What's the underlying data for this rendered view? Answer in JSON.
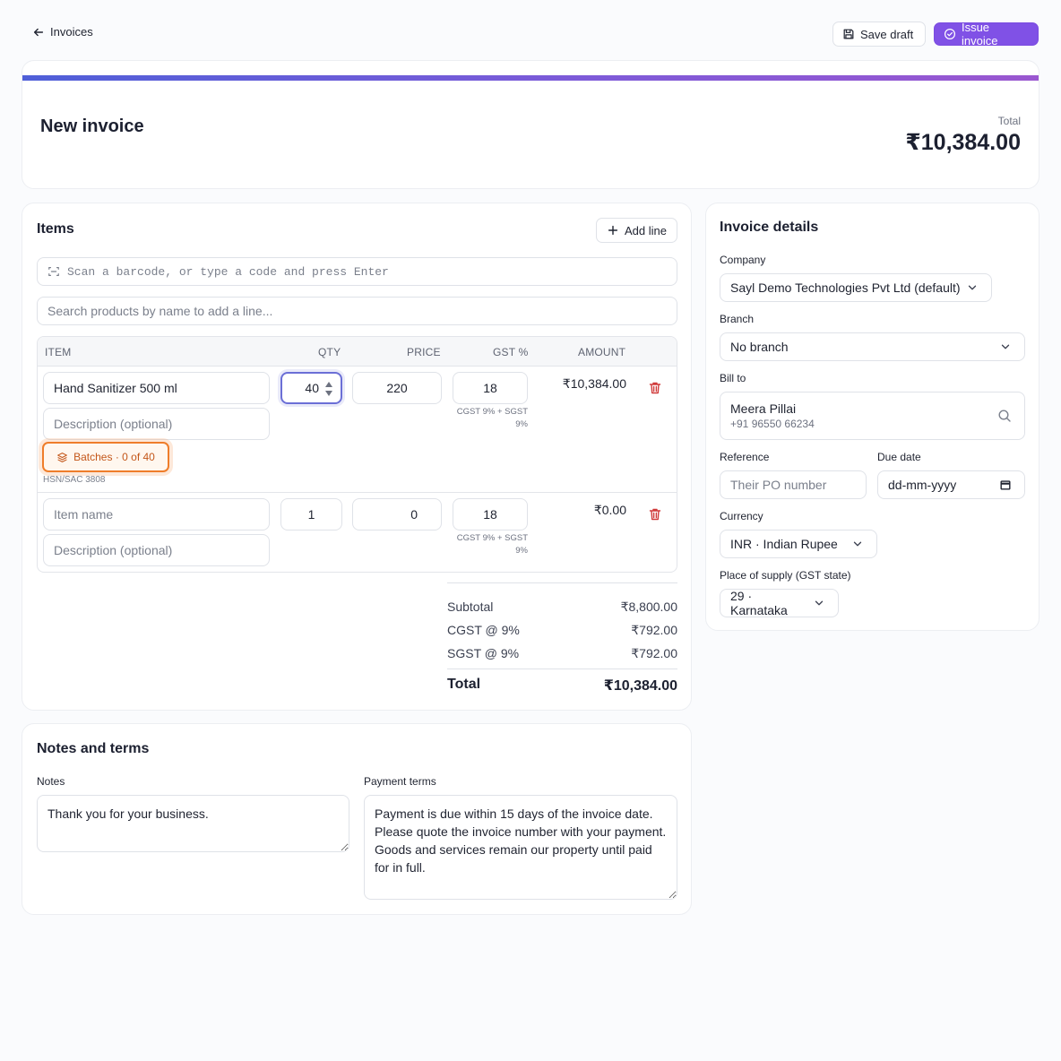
{
  "topbar": {
    "back_label": "Invoices",
    "save_draft_label": "Save draft",
    "issue_label": "Issue invoice",
    "accent_color": "#8051e6"
  },
  "header": {
    "title": "New invoice",
    "total_label": "Total",
    "total_value": "₹10,384.00"
  },
  "items": {
    "title": "Items",
    "add_line_label": "Add line",
    "barcode_placeholder": "Scan a barcode, or type a code and press Enter",
    "search_placeholder": "Search products by name to add a line...",
    "columns": [
      "ITEM",
      "QTY",
      "PRICE",
      "GST %",
      "AMOUNT"
    ],
    "lines": [
      {
        "name": "Hand Sanitizer 500 ml",
        "name_placeholder": "Item name",
        "description_placeholder": "Description (optional)",
        "qty": "40",
        "price": "220",
        "gst": "18",
        "tax_note_1": "CGST 9% + SGST",
        "tax_note_2": "9%",
        "amount": "₹10,384.00",
        "batch_label": "Batches · 0 of 40",
        "hsn": "HSN/SAC 3808"
      },
      {
        "name": "",
        "name_placeholder": "Item name",
        "description_placeholder": "Description (optional)",
        "qty": "1",
        "price": "0",
        "gst": "18",
        "tax_note_1": "CGST 9% + SGST",
        "tax_note_2": "9%",
        "amount": "₹0.00"
      }
    ],
    "totals": {
      "subtotal_label": "Subtotal",
      "subtotal": "₹8,800.00",
      "cgst_label": "CGST @ 9%",
      "cgst": "₹792.00",
      "sgst_label": "SGST @ 9%",
      "sgst": "₹792.00",
      "total_label": "Total",
      "total": "₹10,384.00"
    }
  },
  "details": {
    "title": "Invoice details",
    "company_label": "Company",
    "company_value": "Sayl Demo Technologies Pvt Ltd (default)",
    "branch_label": "Branch",
    "branch_value": "No branch",
    "bill_to_label": "Bill to",
    "bill_to_name": "Meera Pillai",
    "bill_to_phone": "+91 96550 66234",
    "reference_label": "Reference",
    "reference_placeholder": "Their PO number",
    "due_date_label": "Due date",
    "due_date_placeholder": "dd-mm-yyyy",
    "currency_label": "Currency",
    "currency_value": "INR · Indian Rupee",
    "supply_label": "Place of supply (GST state)",
    "supply_value": "29 · Karnataka"
  },
  "notes": {
    "title": "Notes and terms",
    "notes_label": "Notes",
    "notes_value": "Thank you for your business.",
    "terms_label": "Payment terms",
    "terms_value": "Payment is due within 15 days of the invoice date. Please quote the invoice number with your payment.\nGoods and services remain our property until paid for in full."
  }
}
